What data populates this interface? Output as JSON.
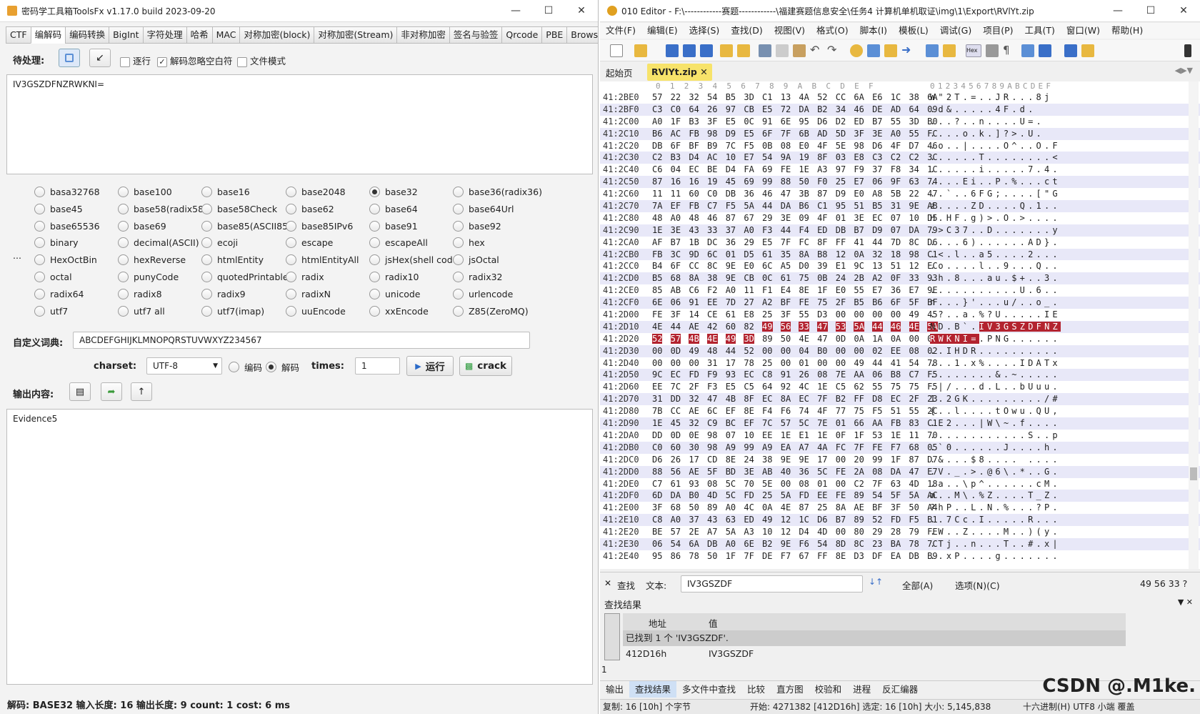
{
  "left": {
    "title": "密码学工具箱ToolsFx v1.17.0 build 2023-09-20",
    "tabs": [
      "CTF",
      "编解码",
      "编码转换",
      "BigInt",
      "字符处理",
      "哈希",
      "MAC",
      "对称加密(block)",
      "对称加密(Stream)",
      "非对称加密",
      "签名与验签",
      "Qrcode",
      "PBE",
      "Brows"
    ],
    "pending_label": "待处理:",
    "opt_run": "逐行",
    "opt_ignore": "解码忽略空白符",
    "opt_file": "文件模式",
    "input_text": "IV3GSZDFNZRWKNI=",
    "encodings": [
      [
        "basa32768",
        "base100",
        "base16",
        "base2048",
        "base32",
        "base36(radix36)"
      ],
      [
        "base45",
        "base58(radix58)",
        "base58Check",
        "base62",
        "base64",
        "base64Url"
      ],
      [
        "base65536",
        "base69",
        "base85(ASCII85)",
        "base85IPv6",
        "base91",
        "base92"
      ],
      [
        "binary",
        "decimal(ASCII)",
        "ecoji",
        "escape",
        "escapeAll",
        "hex"
      ],
      [
        "HexOctBin",
        "hexReverse",
        "htmlEntity",
        "htmlEntityAll",
        "jsHex(shell code)",
        "jsOctal"
      ],
      [
        "octal",
        "punyCode",
        "quotedPrintable",
        "radix",
        "radix10",
        "radix32"
      ],
      [
        "radix64",
        "radix8",
        "radix9",
        "radixN",
        "unicode",
        "urlencode"
      ],
      [
        "utf7",
        "utf7 all",
        "utf7(imap)",
        "uuEncode",
        "xxEncode",
        "Z85(ZeroMQ)"
      ]
    ],
    "selected_encoding": "base32",
    "ellipsis": "...",
    "dict_label": "自定义词典:",
    "dict_value": "ABCDEFGHIJKLMNOPQRSTUVWXYZ234567",
    "charset_label": "charset:",
    "charset_value": "UTF-8",
    "encode_label": "编码",
    "decode_label": "解码",
    "times_label": "times:",
    "times_value": "1",
    "run_button": "运行",
    "crack_button": "crack",
    "output_label": "输出内容:",
    "output_text": "Evidence5",
    "status": "解码: BASE32  输入长度: 16  输出长度: 9 count: 1 cost: 6 ms"
  },
  "right": {
    "title": "010 Editor - F:\\------------赛题------------\\福建赛题信息安全\\任务4 计算机单机取证\\img\\1\\Export\\RVlYt.zip",
    "menu": [
      "文件(F)",
      "编辑(E)",
      "选择(S)",
      "查找(D)",
      "视图(V)",
      "格式(O)",
      "脚本(I)",
      "模板(L)",
      "调试(G)",
      "项目(P)",
      "工具(T)",
      "窗口(W)",
      "帮助(H)"
    ],
    "doc_tabs": {
      "start": "起始页",
      "file": "RVlYt.zip"
    },
    "hex_header": "0  1  2  3  4  5  6  7  8  9  A  B  C  D  E  F",
    "ascii_header": "0123456789ABCDEF",
    "rows": [
      [
        "41:2BE0",
        "57 22 32 54 B5 3D C1 13 4A 52 CC 6A E6 1C 38 6A",
        "W\"2T.=..JR...8j"
      ],
      [
        "41:2BF0",
        "C3 C0 64 26 97 CB E5 72 DA B2 34 46 DE AD 64 09",
        ".d&.....4F.d."
      ],
      [
        "41:2C00",
        "A0 1F B3 3F E5 0C 91 6E 95 D6 D2 ED B7 55 3D B0",
        "...?..n....U=."
      ],
      [
        "41:2C10",
        "B6 AC FB 98 D9 E5 6F 7F 6B AD 5D 3F 3E A0 55 FC",
        "....o.k.]?>.U."
      ],
      [
        "41:2C20",
        "DB 6F BF B9 7C F5 0B 08 E0 4F 5E 98 D6 4F D7 46",
        ".o..|....O^..O.F"
      ],
      [
        "41:2C30",
        "C2 B3 D4 AC 10 E7 54 9A 19 8F 03 E8 C3 C2 C2 3C",
        "......T........<"
      ],
      [
        "41:2C40",
        "C6 04 EC BE D4 FA 69 FE 1E A3 97 F9 37 F8 34 1C",
        "......i.....7.4."
      ],
      [
        "41:2C50",
        "87 16 16 19 45 69 99 88 50 F0 25 E7 06 9F 63 74",
        "....Ei..P.%...ct"
      ],
      [
        "41:2C60",
        "11 11 60 C0 DB 36 46 47 3B 87 D9 E0 A8 5B 22 47",
        "..`..6FG;....[\"G"
      ],
      [
        "41:2C70",
        "7A EF FB C7 F5 5A 44 DA B6 C1 95 51 B5 31 9E AB",
        "z....ZD....Q.1.."
      ],
      [
        "41:2C80",
        "48 A0 48 46 87 67 29 3E 09 4F 01 3E EC 07 10 D5",
        "H.HF.g)>.O.>...."
      ],
      [
        "41:2C90",
        "1E 3E 43 33 37 A0 F3 44 F4 ED DB B7 D9 07 DA 79",
        ".>C37..D.......y"
      ],
      [
        "41:2CA0",
        "AF B7 1B DC 36 29 E5 7F FC 8F FF 41 44 7D 8C D6",
        "....6)......AD}."
      ],
      [
        "41:2CB0",
        "FB 3C 9D 6C 01 D5 61 35 8A B8 12 0A 32 18 98 C1",
        ".<.l..a5....2..."
      ],
      [
        "41:2CC0",
        "B4 6F CC 8C 9E E0 6C A5 D0 39 E1 9C 13 51 12 EC",
        ".o....l..9...Q.."
      ],
      [
        "41:2CD0",
        "B5 68 8A 38 9E CB 0C 61 75 0B 24 2B A2 0F 33 93",
        ".h.8...au.$+..3."
      ],
      [
        "41:2CE0",
        "85 AB C6 F2 A0 11 F1 E4 8E 1F E0 55 E7 36 E7 9E",
        "...........U.6.."
      ],
      [
        "41:2CF0",
        "6E 06 91 EE 7D 27 A2 BF FE 75 2F B5 B6 6F 5F BF",
        "n...}'...u/..o_."
      ],
      [
        "41:2D00",
        "FE 3F 14 CE 61 E8 25 3F 55 D3 00 00 00 00 49 45",
        ".?..a.%?U.....IE"
      ],
      [
        "41:2D10",
        "4E 44 AE 42 60 82 49 56 33 47 53 5A 44 46 4E 5A",
        "ND.B`.IV3GSZDFNZ"
      ],
      [
        "41:2D20",
        "52 57 4B 4E 49 3D 89 50 4E 47 0D 0A 1A 0A 00 00",
        "RWKNI=.PNG......"
      ],
      [
        "41:2D30",
        "00 0D 49 48 44 52 00 00 04 B0 00 00 02 EE 08 02",
        "..IHDR.........."
      ],
      [
        "41:2D40",
        "00 00 00 31 17 78 25 00 01 00 00 49 44 41 54 78",
        "...1.x%....IDATx"
      ],
      [
        "41:2D50",
        "9C EC FD F9 93 EC C8 91 26 08 7E AA 06 B8 C7 F5",
        "........&.~....."
      ],
      [
        "41:2D60",
        "EE 7C 2F F3 E5 C5 64 92 4C 1E C5 62 55 75 75 F5",
        ".|/...d.L..bUuu."
      ],
      [
        "41:2D70",
        "31 DD 32 47 4B 8F EC 8A EC 7F B2 FF D8 EC 2F 23",
        "1.2GK........./#"
      ],
      [
        "41:2D80",
        "7B CC AE 6C EF 8E F4 F6 74 4F 77 75 F5 51 55 2C",
        "{..l....tOwu.QU,"
      ],
      [
        "41:2D90",
        "1E 45 32 C9 BC EF 7C 57 5C 7E 01 66 AA FB 83 C1",
        ".E2...|W\\~.f...."
      ],
      [
        "41:2DA0",
        "DD 0D 0E 98 07 10 EE 1E E1 1E 0F 1F 53 1E 11 70",
        "............S..p"
      ],
      [
        "41:2DB0",
        "C0 60 30 98 A9 99 A9 EA A7 4A FC 7F FE F7 68 05",
        ".`0......J....h."
      ],
      [
        "41:2DC0",
        "D6 26 17 CD 8E 24 38 9E 9E 17 00 20 99 1F 87 D7",
        ".&...$8.... ...."
      ],
      [
        "41:2DD0",
        "88 56 AE 5F BD 3E AB 40 36 5C FE 2A 08 DA 47 E7",
        ".V._.>.@6\\.*..G."
      ],
      [
        "41:2DE0",
        "C7 61 93 08 5C 70 5E 00 08 01 00 C2 7F 63 4D 18",
        ".a..\\p^......cM."
      ],
      [
        "41:2DF0",
        "6D DA B0 4D 5C FD 25 5A FD EE FE 89 54 5F 5A AC",
        "m..M\\.%Z....T_Z."
      ],
      [
        "41:2E00",
        "3F 68 50 89 A0 4C 0A 4E 87 25 8A AE BF 3F 50 A4",
        "?hP..L.N.%...?P."
      ],
      [
        "41:2E10",
        "C8 A0 37 43 63 ED 49 12 1C D6 B7 89 52 FD F5 B1",
        "..7Cc.I.....R..."
      ],
      [
        "41:2E20",
        "BE 57 2E A7 5A A3 10 12 D4 4D 00 80 29 28 79 FE",
        ".W..Z....M..)(y."
      ],
      [
        "41:2E30",
        "06 54 6A DB A0 6E B2 9E F6 54 8D 8C 23 BA 78 7C",
        ".Tj..n...T..#.x|"
      ],
      [
        "41:2E40",
        "95 86 78 50 1F 7F DE F7 67 FF 8E D3 DF EA DB B9",
        "..xP....g......."
      ]
    ],
    "find": {
      "label": "查找",
      "text_label": "文本:",
      "value": "IV3GSZDF",
      "all": "全部(A)",
      "options": "选项(N)(C)",
      "hexval": "49 56 33 ?"
    },
    "results": {
      "title": "查找结果",
      "col_addr": "地址",
      "col_val": "值",
      "found": "已找到 1 个 'IV3GSZDF'.",
      "addr": "412D16h",
      "val": "IV3GSZDF",
      "num": "1"
    },
    "bottom_tabs": [
      "输出",
      "查找结果",
      "多文件中查找",
      "比较",
      "直方图",
      "校验和",
      "进程",
      "反汇编器"
    ],
    "watermark": "CSDN @.M1ke.",
    "status": "复制: 16 [10h] 个字节",
    "status2": "开始: 4271382 [412D16h]  选定: 16 [10h]  大小: 5,145,838",
    "status3": "十六进制(H)  UTF8  小端  覆盖"
  },
  "colors": {
    "highlight": "#b3232f",
    "accent": "#2a6ac8",
    "find_tab": "#cfe0f5"
  }
}
